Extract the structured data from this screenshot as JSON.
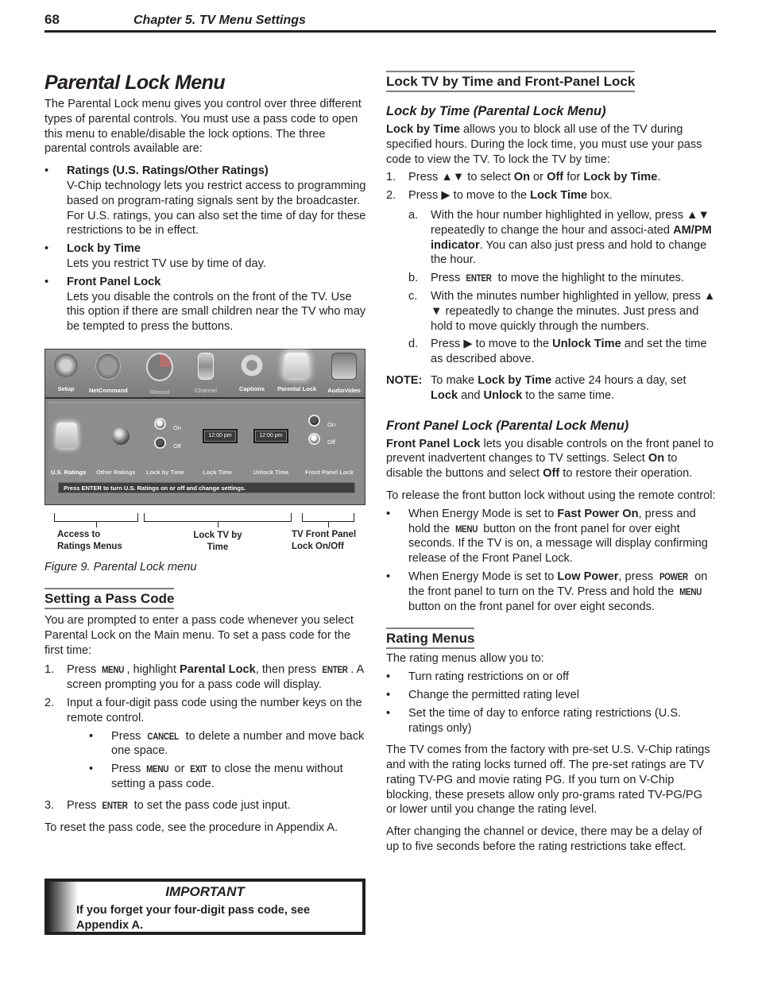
{
  "header": {
    "page_number": "68",
    "chapter": "Chapter 5. TV Menu Settings"
  },
  "left": {
    "title": "Parental Lock Menu",
    "intro": "The Parental Lock menu gives you control over three different types of parental controls.  You must use a pass code to open this menu to enable/disable the lock options.  The three parental controls available are:",
    "bullets": [
      {
        "title": "Ratings (U.S. Ratings/Other Ratings)",
        "text": "V-Chip technology lets you restrict access to programming based on program-rating signals sent by the broadcaster.  For U.S. ratings, you can also set the time of day for these restrictions to be in effect."
      },
      {
        "title": "Lock by Time",
        "text": "Lets you restrict TV use by time of day."
      },
      {
        "title": "Front Panel Lock",
        "text": "Lets you disable the controls on the front of the TV.  Use this option if there are small children near the TV who may be tempted to press the buttons."
      }
    ],
    "figure": {
      "menu_items": [
        "Setup",
        "NetCommand",
        "Record",
        "Channel",
        "Captions",
        "Parental Lock",
        "AudioVideo"
      ],
      "controls": [
        "U.S. Ratings",
        "Other Ratings",
        "Lock by Time",
        "Lock Time",
        "Unlock Time",
        "Front Panel Lock"
      ],
      "radio_on": "On",
      "radio_off": "Off",
      "lock_time": "12:00 pm",
      "unlock_time": "12:00 pm",
      "lock_by_time_state": "On",
      "front_panel_lock_state": "Off",
      "status": "Press ENTER to turn U.S. Ratings on or off and change settings.",
      "callouts": [
        "Access to Ratings Menus",
        "Lock TV by Time",
        "TV Front Panel Lock On/Off"
      ],
      "callout_lines": [
        [
          "Access to",
          "Ratings Menus"
        ],
        [
          "Lock TV by",
          "Time"
        ],
        [
          "TV Front Panel",
          "Lock On/Off"
        ]
      ],
      "caption": "Figure 9.  Parental Lock menu"
    },
    "passcode": {
      "heading": "Setting a Pass Code",
      "intro": "You are prompted to enter a pass code whenever you select Parental Lock on the Main menu.  To set a pass code for the first time:",
      "step1": {
        "n": "1.",
        "a": "Press ",
        "k1": "MENU",
        "b": ", highlight ",
        "bold": "Parental Lock",
        "c": ", then press ",
        "k2": "ENTER",
        "d": ".  A screen prompting you for a pass code will display."
      },
      "step2": {
        "n": "2.",
        "text": "Input a four-digit pass code using the number keys on the remote control."
      },
      "sub1": {
        "a": "Press ",
        "k": "CANCEL",
        "b": " to delete a number and move back one space."
      },
      "sub2": {
        "a": "Press ",
        "k1": "MENU",
        "b": " or ",
        "k2": "EXIT",
        "c": " to close the menu without setting a pass code."
      },
      "step3": {
        "n": "3.",
        "a": "Press ",
        "k": "ENTER",
        "b": " to set the pass code just input."
      },
      "reset": "To reset the pass code, see the procedure in Appendix A."
    },
    "important": {
      "title": "IMPORTANT",
      "text": "If you forget your four-digit pass code, see Appendix A."
    }
  },
  "right": {
    "heading": "Lock TV by Time and Front-Panel Lock",
    "lock_by_time": {
      "subheading": "Lock by Time (Parental Lock Menu)",
      "intro_bold": "Lock by Time",
      "intro": " allows you to block all use of the TV during specified hours.  During the lock time, you must use your pass code to view the TV.  To lock the TV by time:",
      "step1": {
        "n": "1.",
        "a": "Press ▲▼ to select ",
        "b1": "On",
        "c": " or ",
        "b2": "Off",
        "d": " for ",
        "b3": "Lock by Time",
        "e": "."
      },
      "step2": {
        "n": "2.",
        "a": "Press ▶ to move to the ",
        "b": "Lock Time",
        "c": " box."
      },
      "sub_a": {
        "n": "a.",
        "a": "With the hour number highlighted in yellow, press ▲▼ repeatedly to change the hour and associ-ated ",
        "b": "AM/PM indicator",
        "c": ".  You can also just press and hold to change the hour."
      },
      "sub_b": {
        "n": "b.",
        "a": "Press ",
        "k": "ENTER",
        "c": " to move the highlight to the minutes."
      },
      "sub_c": {
        "n": "c.",
        "text": "With the minutes number highlighted in yellow, press ▲ ▼ repeatedly to change the minutes.  Just press and hold to move quickly through the numbers."
      },
      "sub_d": {
        "n": "d.",
        "a": "Press ▶ to move to the ",
        "b": "Unlock Time",
        "c": " and set the time as described above."
      },
      "note": {
        "label": "NOTE:",
        "a": "To make ",
        "b1": "Lock by Time",
        "c": " active 24 hours a day, set ",
        "b2": "Lock",
        "d": " and ",
        "b3": "Unlock",
        "e": " to the same time."
      }
    },
    "front_panel": {
      "subheading": "Front Panel Lock (Parental Lock Menu)",
      "p1": {
        "b": "Front Panel Lock",
        "a": " lets you disable controls on the front panel to prevent inadvertent changes to TV settings.  Select ",
        "b1": "On",
        "c": " to disable the buttons and select ",
        "b2": "Off",
        "d": " to restore their operation."
      },
      "p2": "To release the front button lock without using the remote control:",
      "bullet1": {
        "a": "When Energy Mode is set to ",
        "b": "Fast Power On",
        "c": ", press and hold the ",
        "k": "MENU",
        "d": " button on the front panel for over eight seconds.  If the TV is on, a message will display confirming release of the Front Panel Lock."
      },
      "bullet2": {
        "a": "When Energy Mode is set to ",
        "b": "Low Power",
        "c": ", press ",
        "k1": "POWER",
        "d": " on the front panel to turn on the TV.  Press and hold the ",
        "k2": "MENU",
        "e": " button on the front panel for over eight seconds."
      }
    },
    "rating_menus": {
      "heading": "Rating Menus",
      "intro": "The rating menus allow you to:",
      "bullets": [
        "Turn rating restrictions on or off",
        "Change the permitted rating level",
        "Set the time of day to enforce rating restrictions (U.S. ratings only)"
      ],
      "p1": "The TV comes from the factory with pre-set U.S. V-Chip ratings and with the rating locks turned off.  The pre-set ratings are TV rating TV-PG and movie rating PG.  If you turn on V-Chip blocking, these presets allow only pro-grams rated TV-PG/PG or lower until you change the rating level.",
      "p2": "After changing the channel or device, there may be a delay of up to five seconds before the rating restrictions take effect."
    }
  }
}
